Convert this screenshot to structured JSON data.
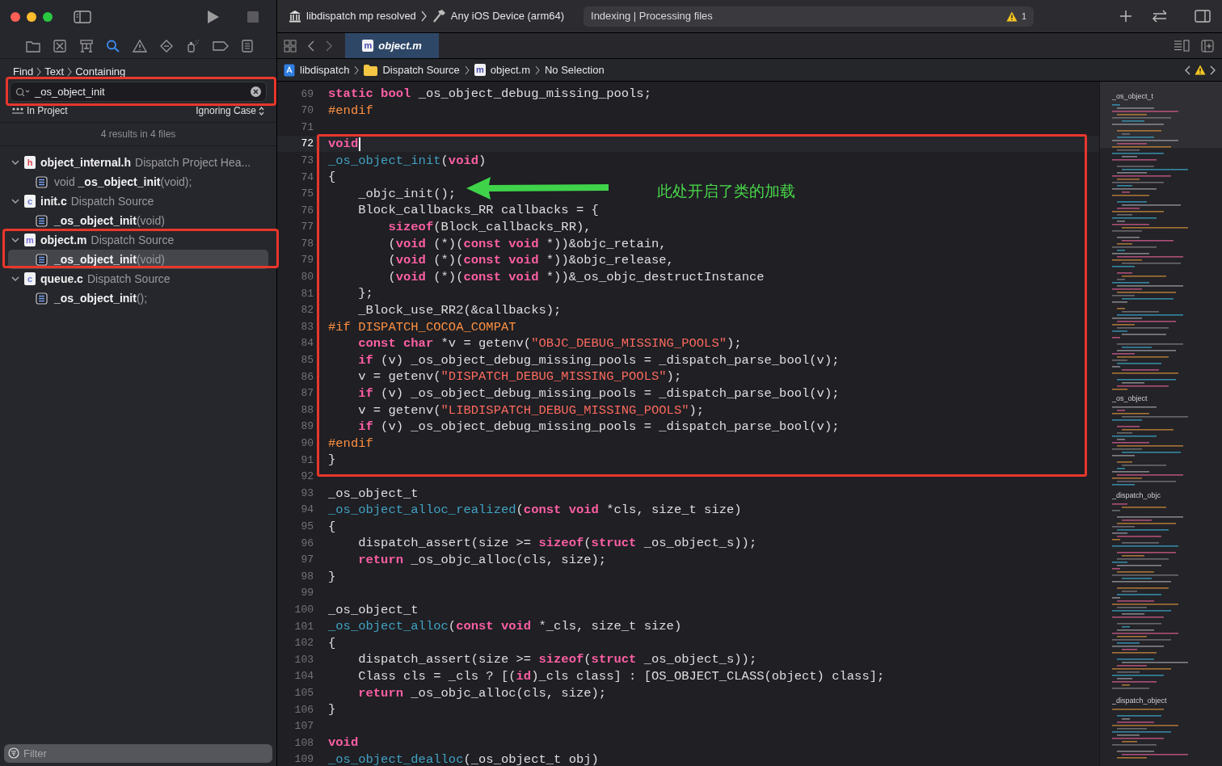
{
  "toolbar": {
    "scheme": "libdispatch mp resolved",
    "destination": "Any iOS Device (arm64)",
    "activity": "Indexing | Processing files",
    "warning_count": "1"
  },
  "find_navigator": {
    "breadcrumb": [
      "Find",
      "Text",
      "Containing"
    ],
    "search_value": "_os_object_init",
    "scope": "In Project",
    "case_mode": "Ignoring Case",
    "summary": "4 results in 4 files",
    "results": [
      {
        "icon_letter": "h",
        "file": "object_internal.h",
        "location": "Dispatch Project Hea...",
        "expanded": true,
        "children": [
          {
            "text": "void **_os_object_init**(void);",
            "selected": false
          }
        ]
      },
      {
        "icon_letter": "c",
        "file": "init.c",
        "location": "Dispatch Source",
        "expanded": true,
        "children": [
          {
            "text": "**_os_object_init**(void)",
            "selected": false
          }
        ]
      },
      {
        "icon_letter": "m",
        "file": "object.m",
        "location": "Dispatch Source",
        "expanded": true,
        "children": [
          {
            "text": "**_os_object_init**(void)",
            "selected": true
          }
        ]
      },
      {
        "icon_letter": "c",
        "file": "queue.c",
        "location": "Dispatch Source",
        "expanded": true,
        "children": [
          {
            "text": "**_os_object_init**();",
            "selected": false
          }
        ]
      }
    ],
    "filter_placeholder": "Filter"
  },
  "editor": {
    "tab": {
      "icon_letter": "m",
      "title": "object.m",
      "selected": true
    },
    "jump_bar": [
      "libdispatch",
      "Dispatch Source",
      "object.m",
      "No Selection"
    ],
    "jump_bar_file_icon_letter": "m",
    "annotation": "此处开启了类的加载",
    "lines": [
      {
        "number": "69",
        "current": false,
        "tokens": [
          {
            "kind": "keyword",
            "text": "static"
          },
          {
            "kind": "keyword",
            "text": " bool"
          },
          {
            "kind": "plain",
            "text": " _os_object_debug_missing_pools;"
          }
        ]
      },
      {
        "number": "70",
        "current": false,
        "tokens": [
          {
            "kind": "preprocessor",
            "text": "#endif"
          }
        ]
      },
      {
        "number": "71",
        "current": false
      },
      {
        "number": "72",
        "current": true,
        "tokens": [
          {
            "kind": "keyword",
            "text": "void"
          }
        ]
      },
      {
        "number": "73",
        "current": false,
        "tokens": [
          {
            "kind": "declaration",
            "text": "_os_object_init"
          },
          {
            "kind": "plain",
            "text": "("
          },
          {
            "kind": "keyword",
            "text": "void"
          },
          {
            "kind": "plain",
            "text": ")"
          }
        ]
      },
      {
        "number": "74",
        "current": false,
        "tokens": [
          {
            "kind": "plain",
            "text": "{"
          }
        ]
      },
      {
        "number": "75",
        "current": false,
        "tokens": [
          {
            "kind": "plain",
            "text": "    _objc_init();"
          }
        ]
      },
      {
        "number": "76",
        "current": false,
        "tokens": [
          {
            "kind": "plain",
            "text": "    Block_callbacks_RR callbacks = {"
          }
        ]
      },
      {
        "number": "77",
        "current": false,
        "tokens": [
          {
            "kind": "keyword",
            "text": "        sizeof"
          },
          {
            "kind": "plain",
            "text": "(Block_callbacks_RR),"
          }
        ]
      },
      {
        "number": "78",
        "current": false,
        "tokens": [
          {
            "kind": "plain",
            "text": "        ("
          },
          {
            "kind": "keyword",
            "text": "void"
          },
          {
            "kind": "plain",
            "text": " (*)("
          },
          {
            "kind": "keyword",
            "text": "const"
          },
          {
            "kind": "keyword",
            "text": " void"
          },
          {
            "kind": "plain",
            "text": " *))&objc_retain,"
          }
        ]
      },
      {
        "number": "79",
        "current": false,
        "tokens": [
          {
            "kind": "plain",
            "text": "        ("
          },
          {
            "kind": "keyword",
            "text": "void"
          },
          {
            "kind": "plain",
            "text": " (*)("
          },
          {
            "kind": "keyword",
            "text": "const"
          },
          {
            "kind": "keyword",
            "text": " void"
          },
          {
            "kind": "plain",
            "text": " *))&objc_release,"
          }
        ]
      },
      {
        "number": "80",
        "current": false,
        "tokens": [
          {
            "kind": "plain",
            "text": "        ("
          },
          {
            "kind": "keyword",
            "text": "void"
          },
          {
            "kind": "plain",
            "text": " (*)("
          },
          {
            "kind": "keyword",
            "text": "const"
          },
          {
            "kind": "keyword",
            "text": " void"
          },
          {
            "kind": "plain",
            "text": " *))&_os_objc_destructInstance"
          }
        ]
      },
      {
        "number": "81",
        "current": false,
        "tokens": [
          {
            "kind": "plain",
            "text": "    };"
          }
        ]
      },
      {
        "number": "82",
        "current": false,
        "tokens": [
          {
            "kind": "plain",
            "text": "    _Block_use_RR2(&callbacks);"
          }
        ]
      },
      {
        "number": "83",
        "current": false,
        "tokens": [
          {
            "kind": "preprocessor",
            "text": "#if DISPATCH_COCOA_COMPAT"
          }
        ]
      },
      {
        "number": "84",
        "current": false,
        "tokens": [
          {
            "kind": "keyword",
            "text": "    const"
          },
          {
            "kind": "keyword",
            "text": " char"
          },
          {
            "kind": "plain",
            "text": " *v = getenv("
          },
          {
            "kind": "string",
            "text": "\"OBJC_DEBUG_MISSING_POOLS\""
          },
          {
            "kind": "plain",
            "text": ");"
          }
        ]
      },
      {
        "number": "85",
        "current": false,
        "tokens": [
          {
            "kind": "keyword",
            "text": "    if"
          },
          {
            "kind": "plain",
            "text": " (v) _os_object_debug_missing_pools = _dispatch_parse_bool(v);"
          }
        ]
      },
      {
        "number": "86",
        "current": false,
        "tokens": [
          {
            "kind": "plain",
            "text": "    v = getenv("
          },
          {
            "kind": "string",
            "text": "\"DISPATCH_DEBUG_MISSING_POOLS\""
          },
          {
            "kind": "plain",
            "text": ");"
          }
        ]
      },
      {
        "number": "87",
        "current": false,
        "tokens": [
          {
            "kind": "keyword",
            "text": "    if"
          },
          {
            "kind": "plain",
            "text": " (v) _os_object_debug_missing_pools = _dispatch_parse_bool(v);"
          }
        ]
      },
      {
        "number": "88",
        "current": false,
        "tokens": [
          {
            "kind": "plain",
            "text": "    v = getenv("
          },
          {
            "kind": "string",
            "text": "\"LIBDISPATCH_DEBUG_MISSING_POOLS\""
          },
          {
            "kind": "plain",
            "text": ");"
          }
        ]
      },
      {
        "number": "89",
        "current": false,
        "tokens": [
          {
            "kind": "keyword",
            "text": "    if"
          },
          {
            "kind": "plain",
            "text": " (v) _os_object_debug_missing_pools = _dispatch_parse_bool(v);"
          }
        ]
      },
      {
        "number": "90",
        "current": false,
        "tokens": [
          {
            "kind": "preprocessor",
            "text": "#endif"
          }
        ]
      },
      {
        "number": "91",
        "current": false,
        "tokens": [
          {
            "kind": "plain",
            "text": "}"
          }
        ]
      },
      {
        "number": "92",
        "current": false
      },
      {
        "number": "93",
        "current": false,
        "tokens": [
          {
            "kind": "plain",
            "text": "_os_object_t"
          }
        ]
      },
      {
        "number": "94",
        "current": false,
        "tokens": [
          {
            "kind": "declaration",
            "text": "_os_object_alloc_realized"
          },
          {
            "kind": "plain",
            "text": "("
          },
          {
            "kind": "keyword",
            "text": "const"
          },
          {
            "kind": "keyword",
            "text": " void"
          },
          {
            "kind": "plain",
            "text": " *cls, size_t size)"
          }
        ]
      },
      {
        "number": "95",
        "current": false,
        "tokens": [
          {
            "kind": "plain",
            "text": "{"
          }
        ]
      },
      {
        "number": "96",
        "current": false,
        "tokens": [
          {
            "kind": "plain",
            "text": "    dispatch_assert(size >= "
          },
          {
            "kind": "keyword",
            "text": "sizeof"
          },
          {
            "kind": "plain",
            "text": "("
          },
          {
            "kind": "keyword",
            "text": "struct"
          },
          {
            "kind": "plain",
            "text": " _os_object_s));"
          }
        ]
      },
      {
        "number": "97",
        "current": false,
        "tokens": [
          {
            "kind": "keyword",
            "text": "    return"
          },
          {
            "kind": "plain",
            "text": " _os_objc_alloc(cls, size);"
          }
        ]
      },
      {
        "number": "98",
        "current": false,
        "tokens": [
          {
            "kind": "plain",
            "text": "}"
          }
        ]
      },
      {
        "number": "99",
        "current": false
      },
      {
        "number": "100",
        "current": false,
        "tokens": [
          {
            "kind": "plain",
            "text": "_os_object_t"
          }
        ]
      },
      {
        "number": "101",
        "current": false,
        "tokens": [
          {
            "kind": "declaration",
            "text": "_os_object_alloc"
          },
          {
            "kind": "plain",
            "text": "("
          },
          {
            "kind": "keyword",
            "text": "const"
          },
          {
            "kind": "keyword",
            "text": " void"
          },
          {
            "kind": "plain",
            "text": " *_cls, size_t size)"
          }
        ]
      },
      {
        "number": "102",
        "current": false,
        "tokens": [
          {
            "kind": "plain",
            "text": "{"
          }
        ]
      },
      {
        "number": "103",
        "current": false,
        "tokens": [
          {
            "kind": "plain",
            "text": "    dispatch_assert(size >= "
          },
          {
            "kind": "keyword",
            "text": "sizeof"
          },
          {
            "kind": "plain",
            "text": "("
          },
          {
            "kind": "keyword",
            "text": "struct"
          },
          {
            "kind": "plain",
            "text": " _os_object_s));"
          }
        ]
      },
      {
        "number": "104",
        "current": false,
        "tokens": [
          {
            "kind": "plain",
            "text": "    Class cls = _cls ? [("
          },
          {
            "kind": "keyword",
            "text": "id"
          },
          {
            "kind": "plain",
            "text": ")_cls class] : [OS_OBJECT_CLASS(object) class];"
          }
        ]
      },
      {
        "number": "105",
        "current": false,
        "tokens": [
          {
            "kind": "keyword",
            "text": "    return"
          },
          {
            "kind": "plain",
            "text": " _os_objc_alloc(cls, size);"
          }
        ]
      },
      {
        "number": "106",
        "current": false,
        "tokens": [
          {
            "kind": "plain",
            "text": "}"
          }
        ]
      },
      {
        "number": "107",
        "current": false
      },
      {
        "number": "108",
        "current": false,
        "tokens": [
          {
            "kind": "keyword",
            "text": "void"
          }
        ]
      },
      {
        "number": "109",
        "current": false,
        "tokens": [
          {
            "kind": "declaration",
            "text": "_os_object_dealloc"
          },
          {
            "kind": "plain",
            "text": "(_os_object_t obj)"
          }
        ]
      }
    ],
    "minimap_sections": [
      "_os_object_t",
      "_os_object",
      "_dispatch_objc",
      "_dispatch_object"
    ]
  }
}
